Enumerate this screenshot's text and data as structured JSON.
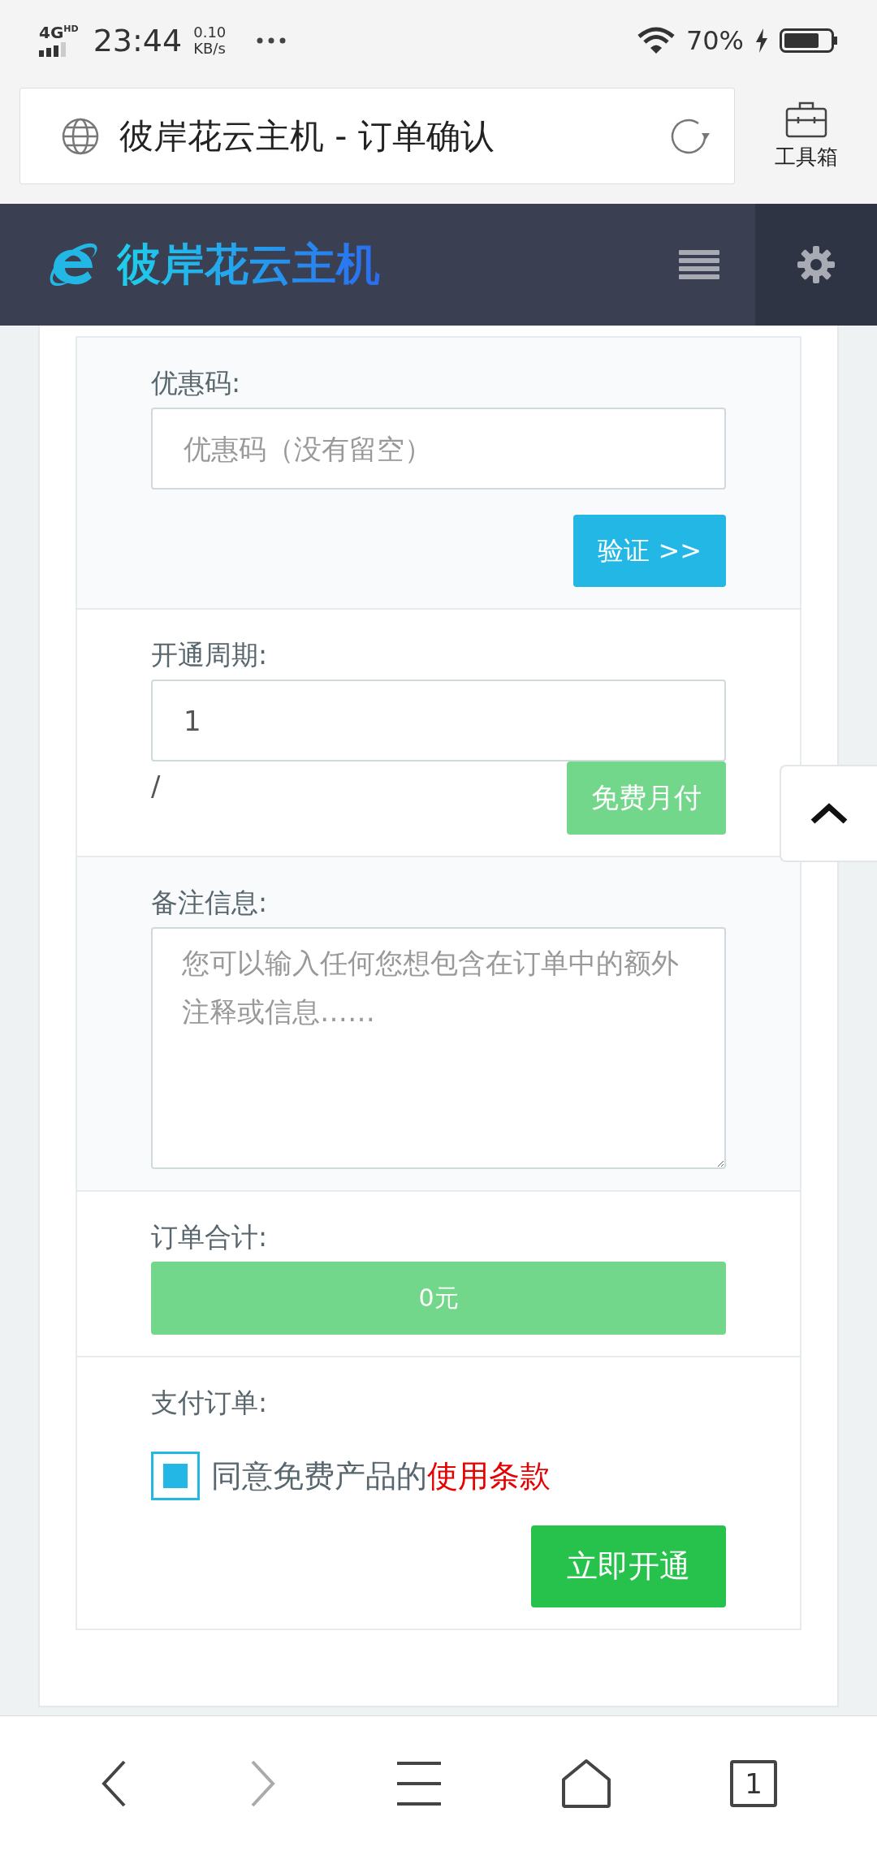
{
  "status_bar": {
    "network": "4G",
    "network_badge": "HD",
    "time": "23:44",
    "speed": "0.10",
    "speed_unit": "KB/s",
    "battery": "70%"
  },
  "browser": {
    "page_title": "彼岸花云主机 - 订单确认",
    "toolbox_label": "工具箱",
    "tab_count": "1"
  },
  "navbar": {
    "brand": "彼岸花云主机"
  },
  "sections": [
    {
      "kind": "coupon",
      "label": "优惠码:",
      "placeholder": "优惠码（没有留空）",
      "button": "验证 >>"
    },
    {
      "kind": "period",
      "label": "开通周期:",
      "value": "1",
      "suffix": "/",
      "button": "免费月付"
    },
    {
      "kind": "notes",
      "label": "备注信息:",
      "placeholder": "您可以输入任何您想包含在订单中的额外注释或信息……"
    },
    {
      "kind": "total",
      "label": "订单合计:",
      "amount": "0元"
    },
    {
      "kind": "pay",
      "label": "支付订单:",
      "agree_text": "同意免费产品的",
      "terms_link": "使用条款",
      "checked": true,
      "button": "立即开通"
    }
  ]
}
